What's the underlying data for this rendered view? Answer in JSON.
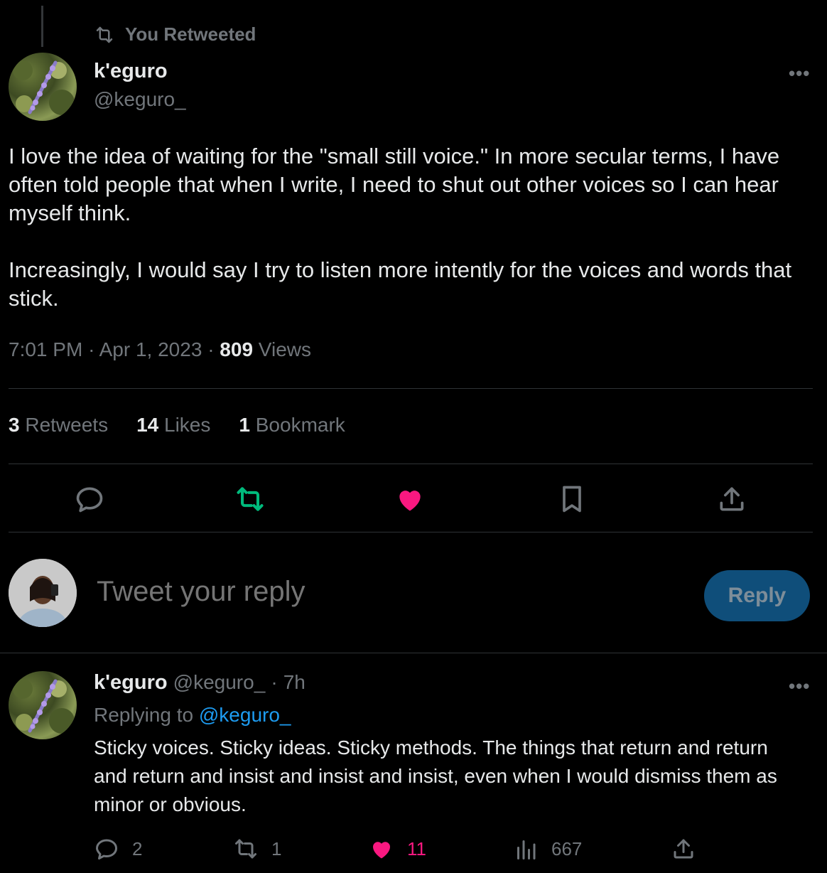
{
  "retweet_header": {
    "label": "You Retweeted"
  },
  "tweet": {
    "author_name": "k'eguro",
    "author_handle": "@keguro_",
    "more_label": "•••",
    "text_paragraphs": [
      "I love the idea of waiting for the \"small still voice.\" In more secular terms, I have often told people that when I write, I need to shut out other voices so I can hear myself think.",
      "Increasingly, I would say I try to listen more intently for the voices and words that stick."
    ],
    "time": "7:01 PM",
    "separator": "·",
    "date": "Apr 1, 2023",
    "views_count": "809",
    "views_label": "Views",
    "stats": {
      "retweets_count": "3",
      "retweets_label": "Retweets",
      "likes_count": "14",
      "likes_label": "Likes",
      "bookmarks_count": "1",
      "bookmarks_label": "Bookmark"
    },
    "actions": {
      "reply_icon": "reply-icon",
      "retweet_icon": "retweet-icon",
      "like_icon": "heart-icon",
      "bookmark_icon": "bookmark-icon",
      "share_icon": "share-icon"
    }
  },
  "compose": {
    "placeholder": "Tweet your reply",
    "button_label": "Reply"
  },
  "reply": {
    "author_name": "k'eguro",
    "author_handle": "@keguro_",
    "dot": "·",
    "age": "7h",
    "more_label": "•••",
    "replying_to_label": "Replying to",
    "replying_to_handle": "@keguro_",
    "text": "Sticky voices. Sticky ideas. Sticky methods. The things that return and return and return and insist and insist and insist, even when I would dismiss them as minor or obvious.",
    "counts": {
      "replies": "2",
      "retweets": "1",
      "likes": "11",
      "views": "667"
    }
  },
  "colors": {
    "background": "#000000",
    "text": "#e7e9ea",
    "muted": "#71767b",
    "retweet_green": "#00ba7c",
    "like_pink": "#f91880",
    "link_blue": "#1d9bf0",
    "reply_button": "#0f4e7a"
  }
}
